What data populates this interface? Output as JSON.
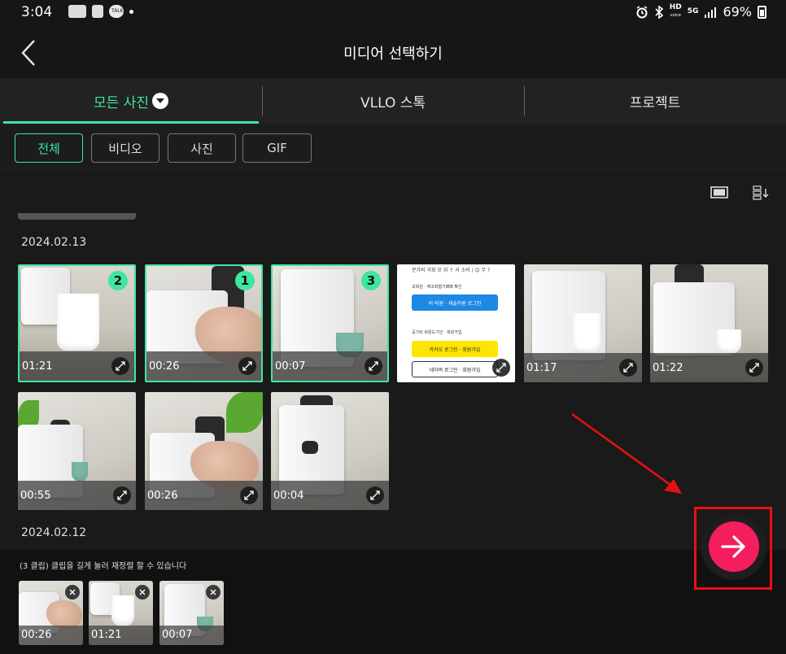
{
  "status_bar": {
    "time": "3:04",
    "left_icons": [
      "app-icon",
      "b-icon",
      "talk-icon",
      "dot-icon"
    ],
    "chip_labels": [
      "",
      "",
      "TALK"
    ],
    "right_icons": [
      "alarm-icon",
      "bluetooth-icon",
      "hd-voice-icon",
      "5g-icon",
      "signal-icon",
      "battery-icon"
    ],
    "hd_label": "HD",
    "net_label": "5G",
    "battery": "69%"
  },
  "header": {
    "title": "미디어 선택하기",
    "back_icon": "chevron-left-icon"
  },
  "tabs": [
    {
      "label": "모든 사진",
      "active": true
    },
    {
      "label": "VLLO 스톡",
      "active": false
    },
    {
      "label": "프로젝트",
      "active": false
    }
  ],
  "filters": [
    {
      "label": "전체",
      "active": true
    },
    {
      "label": "비디오",
      "active": false
    },
    {
      "label": "사진",
      "active": false
    },
    {
      "label": "GIF",
      "active": false
    }
  ],
  "accent_color": "#3ee6a0",
  "next_color": "#f41e5e",
  "groups": [
    {
      "date": "2024.02.13",
      "items": [
        {
          "duration": "01:21",
          "order": "2"
        },
        {
          "duration": "00:26",
          "order": "1"
        },
        {
          "duration": "00:07",
          "order": "3"
        },
        {
          "duration": ""
        },
        {
          "duration": "01:17"
        },
        {
          "duration": "01:22"
        },
        {
          "duration": "00:55"
        },
        {
          "duration": "00:26"
        },
        {
          "duration": "00:04"
        }
      ]
    },
    {
      "date": "2024.02.12",
      "items": []
    }
  ],
  "screenshot_thumb": {
    "line1": "분가비 괴회 모 위 ↑ 서 소비 / 😊 무 ?",
    "section1": "괴회원 · 체코화협기패패 확인",
    "btn1": "비 비원 · 세솔하원 로그인",
    "section2": "공기비 회원도기인 · 회원가입",
    "btn2": "카카오 로그인 · 회원가입",
    "btn3": "네이버 로그인 · 회원가입"
  },
  "bottom_panel": {
    "hint": "(3 클립) 클립을 길게 눌러 재정렬 할 수 있습니다",
    "selected": [
      {
        "duration": "00:26"
      },
      {
        "duration": "01:21"
      },
      {
        "duration": "00:07"
      }
    ]
  }
}
